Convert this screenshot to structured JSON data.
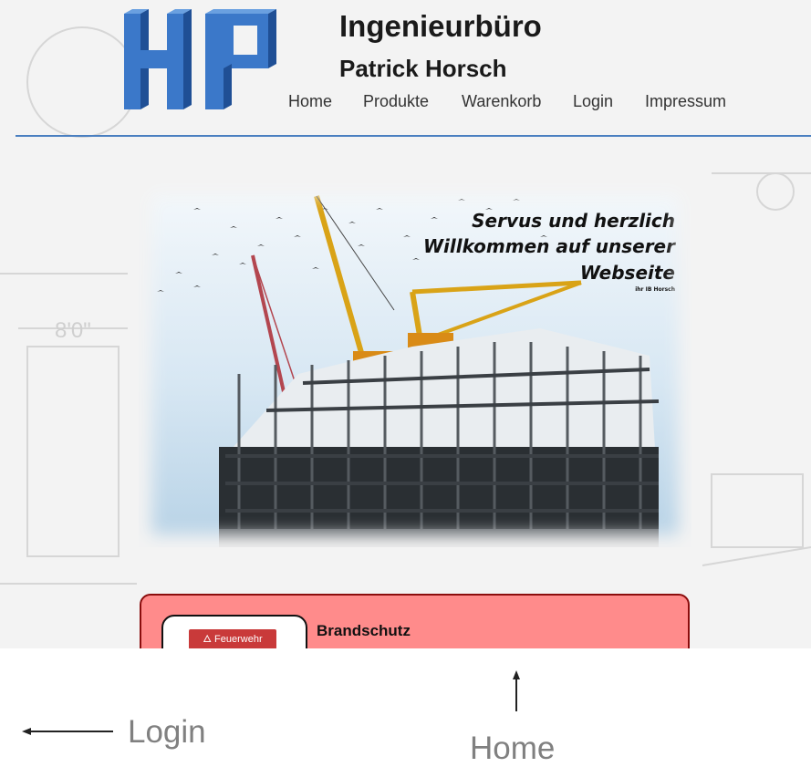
{
  "header": {
    "logo_letters": "HP",
    "title_line1": "Ingenieurbüro",
    "title_line2": "Patrick Horsch"
  },
  "nav": {
    "items": [
      {
        "label": "Home"
      },
      {
        "label": "Produkte"
      },
      {
        "label": "Warenkorb"
      },
      {
        "label": "Login"
      },
      {
        "label": "Impressum"
      }
    ]
  },
  "hero": {
    "line1": "Servus und herzlich",
    "line2": "Willkommen auf unserer",
    "line3": "Webseite",
    "line4": "ihr IB Horsch"
  },
  "product_card": {
    "image_label": "Feuerwehr",
    "title": "Brandschutz"
  },
  "annotations": {
    "login_label": "Login",
    "home_label": "Home"
  },
  "colors": {
    "accent_rule": "#4a7fc0",
    "logo_blue": "#3b78c9",
    "card_fill": "#ff8b8b",
    "card_border": "#8b0d0d"
  }
}
